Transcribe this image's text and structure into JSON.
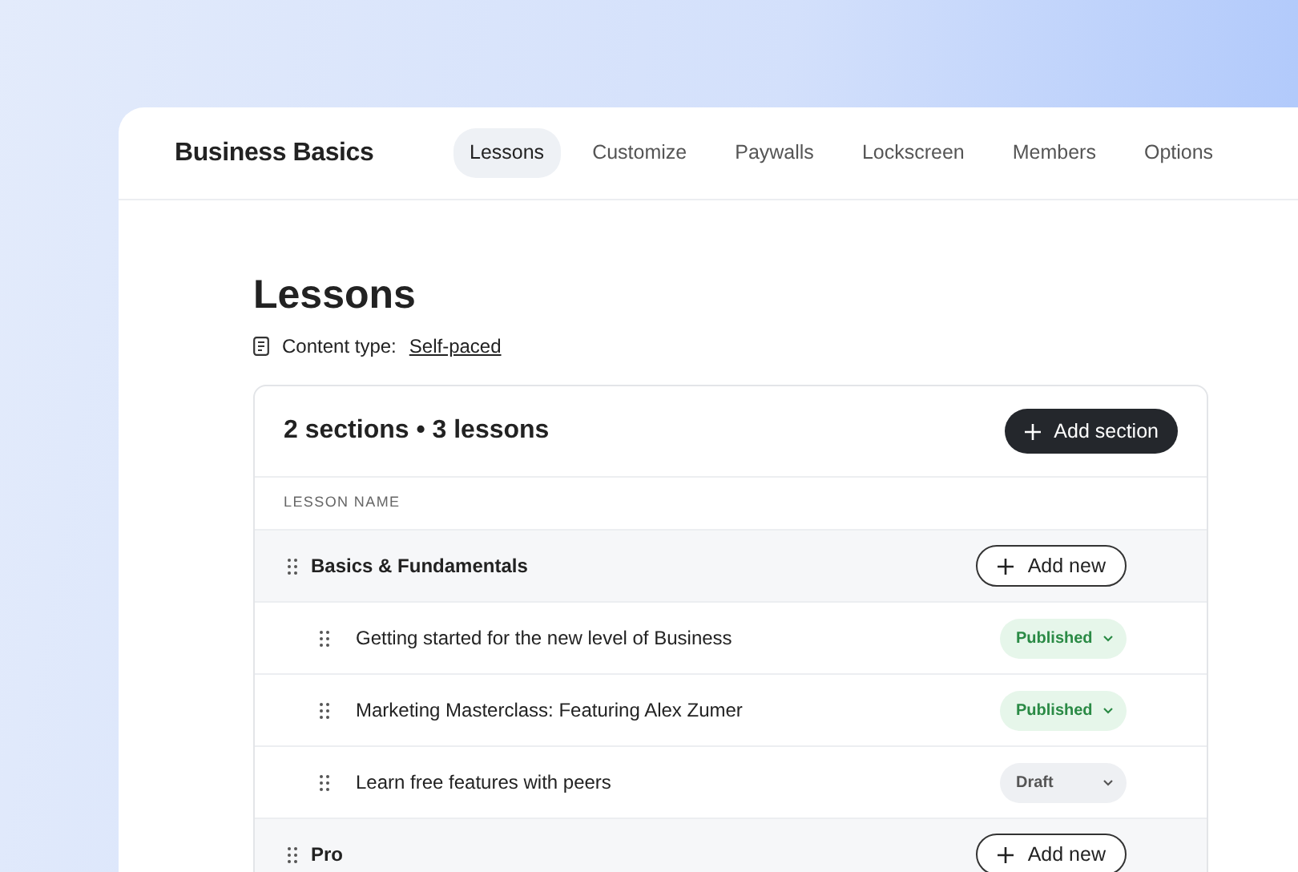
{
  "app": {
    "title": "Business Basics"
  },
  "tabs": [
    {
      "label": "Lessons",
      "selected": true
    },
    {
      "label": "Customize",
      "selected": false
    },
    {
      "label": "Paywalls",
      "selected": false
    },
    {
      "label": "Lockscreen",
      "selected": false
    },
    {
      "label": "Members",
      "selected": false
    },
    {
      "label": "Options",
      "selected": false
    }
  ],
  "page": {
    "heading": "Lessons",
    "content_type_label": "Content type:",
    "content_type_value": "Self-paced"
  },
  "lessons_card": {
    "summary": "2 sections • 3 lessons",
    "add_section_button": "Add section",
    "column_header": "LESSON NAME",
    "sections": [
      {
        "name": "Basics & Fundamentals",
        "add_button": "Add new",
        "children": [
          {
            "name": "Getting started for the new level of Business",
            "status": "Published",
            "kind": "published"
          },
          {
            "name": "Marketing Masterclass: Featuring Alex Zumer",
            "status": "Published",
            "kind": "published"
          },
          {
            "name": "Learn free features with peers",
            "status": "Draft",
            "kind": "draft"
          }
        ]
      },
      {
        "name": "Pro",
        "add_button": "Add new"
      }
    ]
  }
}
